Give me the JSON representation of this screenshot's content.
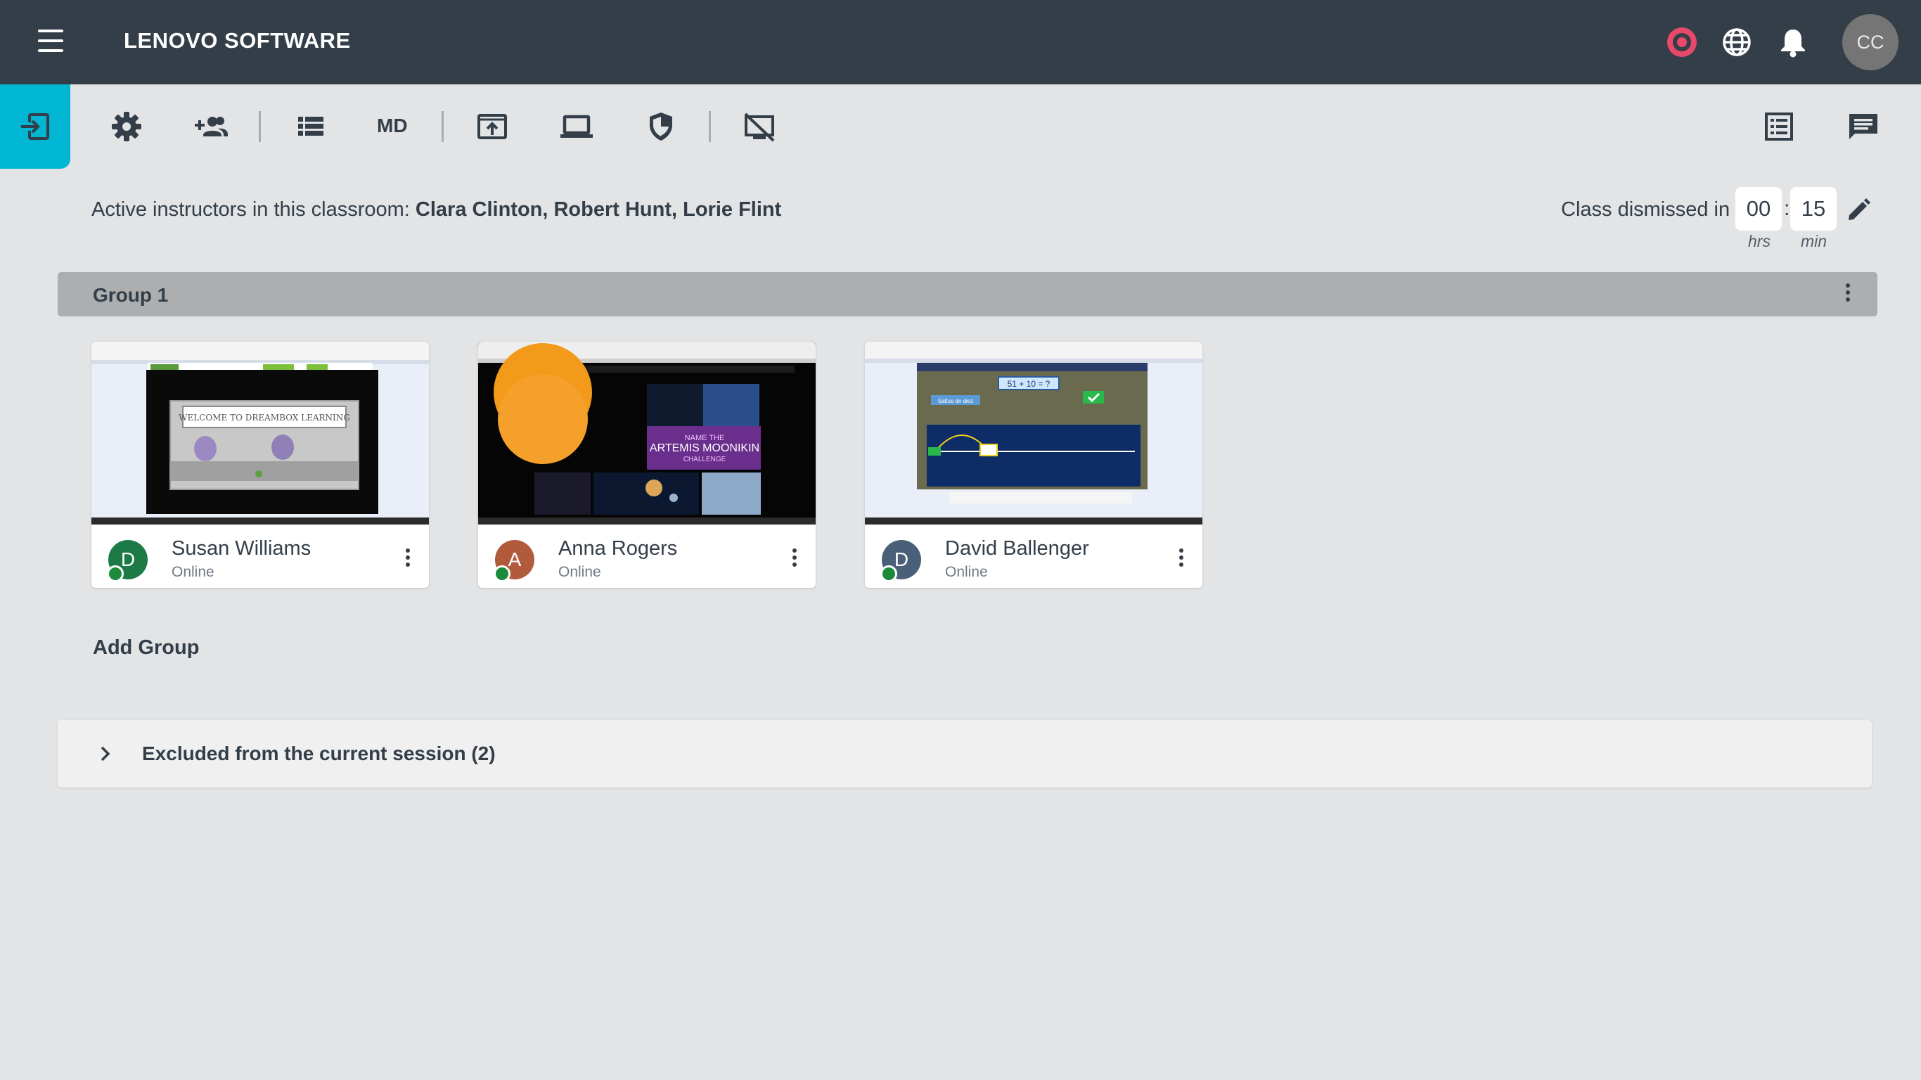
{
  "header": {
    "title": "LENOVO SOFTWARE",
    "avatar_initials": "CC",
    "icons": [
      "menu-icon",
      "record-icon",
      "globe-icon",
      "bell-icon"
    ],
    "colors": {
      "bar": "#333e48",
      "record": "#e8496b"
    }
  },
  "toolbar": {
    "md_label": "MD",
    "accent": "#00b6d2",
    "icons": [
      "exit-icon",
      "gear-icon",
      "add-user-icon",
      "list-icon",
      "share-screen-icon",
      "laptop-icon",
      "shield-icon",
      "screen-off-icon",
      "grid-list-icon",
      "chat-icon"
    ]
  },
  "info": {
    "instructors_label": "Active instructors in this classroom:",
    "instructors_names": "Clara Clinton, Robert Hunt, Lorie Flint",
    "dismiss_label": "Class dismissed in",
    "hours": "00",
    "minutes": "15",
    "hours_unit": "hrs",
    "minutes_unit": "min",
    "colon": ":"
  },
  "group": {
    "title": "Group 1"
  },
  "students": [
    {
      "name": "Susan Williams",
      "status": "Online",
      "initial": "D",
      "avatar_color": "#1b7a45"
    },
    {
      "name": "Anna Rogers",
      "status": "Online",
      "initial": "A",
      "avatar_color": "#b25a3c"
    },
    {
      "name": "David Ballenger",
      "status": "Online",
      "initial": "D",
      "avatar_color": "#4a6079"
    }
  ],
  "thumbnails": {
    "welcome_text": "WELCOME TO DREAMBOX LEARNING",
    "artemis_line1": "NAME THE",
    "artemis_line2": "ARTEMIS MOONIKIN",
    "artemis_line3": "CHALLENGE",
    "equation": "51 + 10 = ?",
    "mode_label": "Saltos de diez"
  },
  "add_group_label": "Add Group",
  "excluded": {
    "label": "Excluded from the current session (2)"
  }
}
